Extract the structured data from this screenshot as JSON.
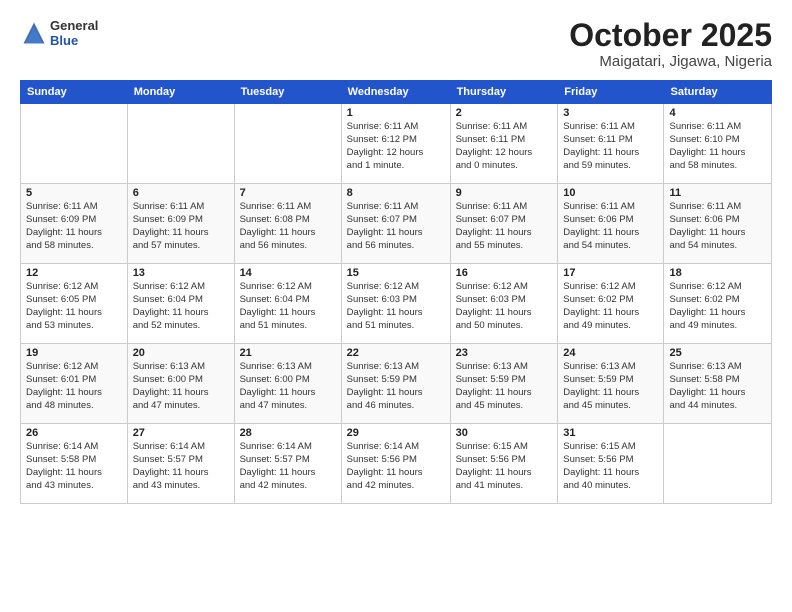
{
  "header": {
    "logo_general": "General",
    "logo_blue": "Blue",
    "month": "October 2025",
    "location": "Maigatari, Jigawa, Nigeria"
  },
  "weekdays": [
    "Sunday",
    "Monday",
    "Tuesday",
    "Wednesday",
    "Thursday",
    "Friday",
    "Saturday"
  ],
  "weeks": [
    [
      {
        "day": "",
        "info": ""
      },
      {
        "day": "",
        "info": ""
      },
      {
        "day": "",
        "info": ""
      },
      {
        "day": "1",
        "info": "Sunrise: 6:11 AM\nSunset: 6:12 PM\nDaylight: 12 hours\nand 1 minute."
      },
      {
        "day": "2",
        "info": "Sunrise: 6:11 AM\nSunset: 6:11 PM\nDaylight: 12 hours\nand 0 minutes."
      },
      {
        "day": "3",
        "info": "Sunrise: 6:11 AM\nSunset: 6:11 PM\nDaylight: 11 hours\nand 59 minutes."
      },
      {
        "day": "4",
        "info": "Sunrise: 6:11 AM\nSunset: 6:10 PM\nDaylight: 11 hours\nand 58 minutes."
      }
    ],
    [
      {
        "day": "5",
        "info": "Sunrise: 6:11 AM\nSunset: 6:09 PM\nDaylight: 11 hours\nand 58 minutes."
      },
      {
        "day": "6",
        "info": "Sunrise: 6:11 AM\nSunset: 6:09 PM\nDaylight: 11 hours\nand 57 minutes."
      },
      {
        "day": "7",
        "info": "Sunrise: 6:11 AM\nSunset: 6:08 PM\nDaylight: 11 hours\nand 56 minutes."
      },
      {
        "day": "8",
        "info": "Sunrise: 6:11 AM\nSunset: 6:07 PM\nDaylight: 11 hours\nand 56 minutes."
      },
      {
        "day": "9",
        "info": "Sunrise: 6:11 AM\nSunset: 6:07 PM\nDaylight: 11 hours\nand 55 minutes."
      },
      {
        "day": "10",
        "info": "Sunrise: 6:11 AM\nSunset: 6:06 PM\nDaylight: 11 hours\nand 54 minutes."
      },
      {
        "day": "11",
        "info": "Sunrise: 6:11 AM\nSunset: 6:06 PM\nDaylight: 11 hours\nand 54 minutes."
      }
    ],
    [
      {
        "day": "12",
        "info": "Sunrise: 6:12 AM\nSunset: 6:05 PM\nDaylight: 11 hours\nand 53 minutes."
      },
      {
        "day": "13",
        "info": "Sunrise: 6:12 AM\nSunset: 6:04 PM\nDaylight: 11 hours\nand 52 minutes."
      },
      {
        "day": "14",
        "info": "Sunrise: 6:12 AM\nSunset: 6:04 PM\nDaylight: 11 hours\nand 51 minutes."
      },
      {
        "day": "15",
        "info": "Sunrise: 6:12 AM\nSunset: 6:03 PM\nDaylight: 11 hours\nand 51 minutes."
      },
      {
        "day": "16",
        "info": "Sunrise: 6:12 AM\nSunset: 6:03 PM\nDaylight: 11 hours\nand 50 minutes."
      },
      {
        "day": "17",
        "info": "Sunrise: 6:12 AM\nSunset: 6:02 PM\nDaylight: 11 hours\nand 49 minutes."
      },
      {
        "day": "18",
        "info": "Sunrise: 6:12 AM\nSunset: 6:02 PM\nDaylight: 11 hours\nand 49 minutes."
      }
    ],
    [
      {
        "day": "19",
        "info": "Sunrise: 6:12 AM\nSunset: 6:01 PM\nDaylight: 11 hours\nand 48 minutes."
      },
      {
        "day": "20",
        "info": "Sunrise: 6:13 AM\nSunset: 6:00 PM\nDaylight: 11 hours\nand 47 minutes."
      },
      {
        "day": "21",
        "info": "Sunrise: 6:13 AM\nSunset: 6:00 PM\nDaylight: 11 hours\nand 47 minutes."
      },
      {
        "day": "22",
        "info": "Sunrise: 6:13 AM\nSunset: 5:59 PM\nDaylight: 11 hours\nand 46 minutes."
      },
      {
        "day": "23",
        "info": "Sunrise: 6:13 AM\nSunset: 5:59 PM\nDaylight: 11 hours\nand 45 minutes."
      },
      {
        "day": "24",
        "info": "Sunrise: 6:13 AM\nSunset: 5:59 PM\nDaylight: 11 hours\nand 45 minutes."
      },
      {
        "day": "25",
        "info": "Sunrise: 6:13 AM\nSunset: 5:58 PM\nDaylight: 11 hours\nand 44 minutes."
      }
    ],
    [
      {
        "day": "26",
        "info": "Sunrise: 6:14 AM\nSunset: 5:58 PM\nDaylight: 11 hours\nand 43 minutes."
      },
      {
        "day": "27",
        "info": "Sunrise: 6:14 AM\nSunset: 5:57 PM\nDaylight: 11 hours\nand 43 minutes."
      },
      {
        "day": "28",
        "info": "Sunrise: 6:14 AM\nSunset: 5:57 PM\nDaylight: 11 hours\nand 42 minutes."
      },
      {
        "day": "29",
        "info": "Sunrise: 6:14 AM\nSunset: 5:56 PM\nDaylight: 11 hours\nand 42 minutes."
      },
      {
        "day": "30",
        "info": "Sunrise: 6:15 AM\nSunset: 5:56 PM\nDaylight: 11 hours\nand 41 minutes."
      },
      {
        "day": "31",
        "info": "Sunrise: 6:15 AM\nSunset: 5:56 PM\nDaylight: 11 hours\nand 40 minutes."
      },
      {
        "day": "",
        "info": ""
      }
    ]
  ]
}
